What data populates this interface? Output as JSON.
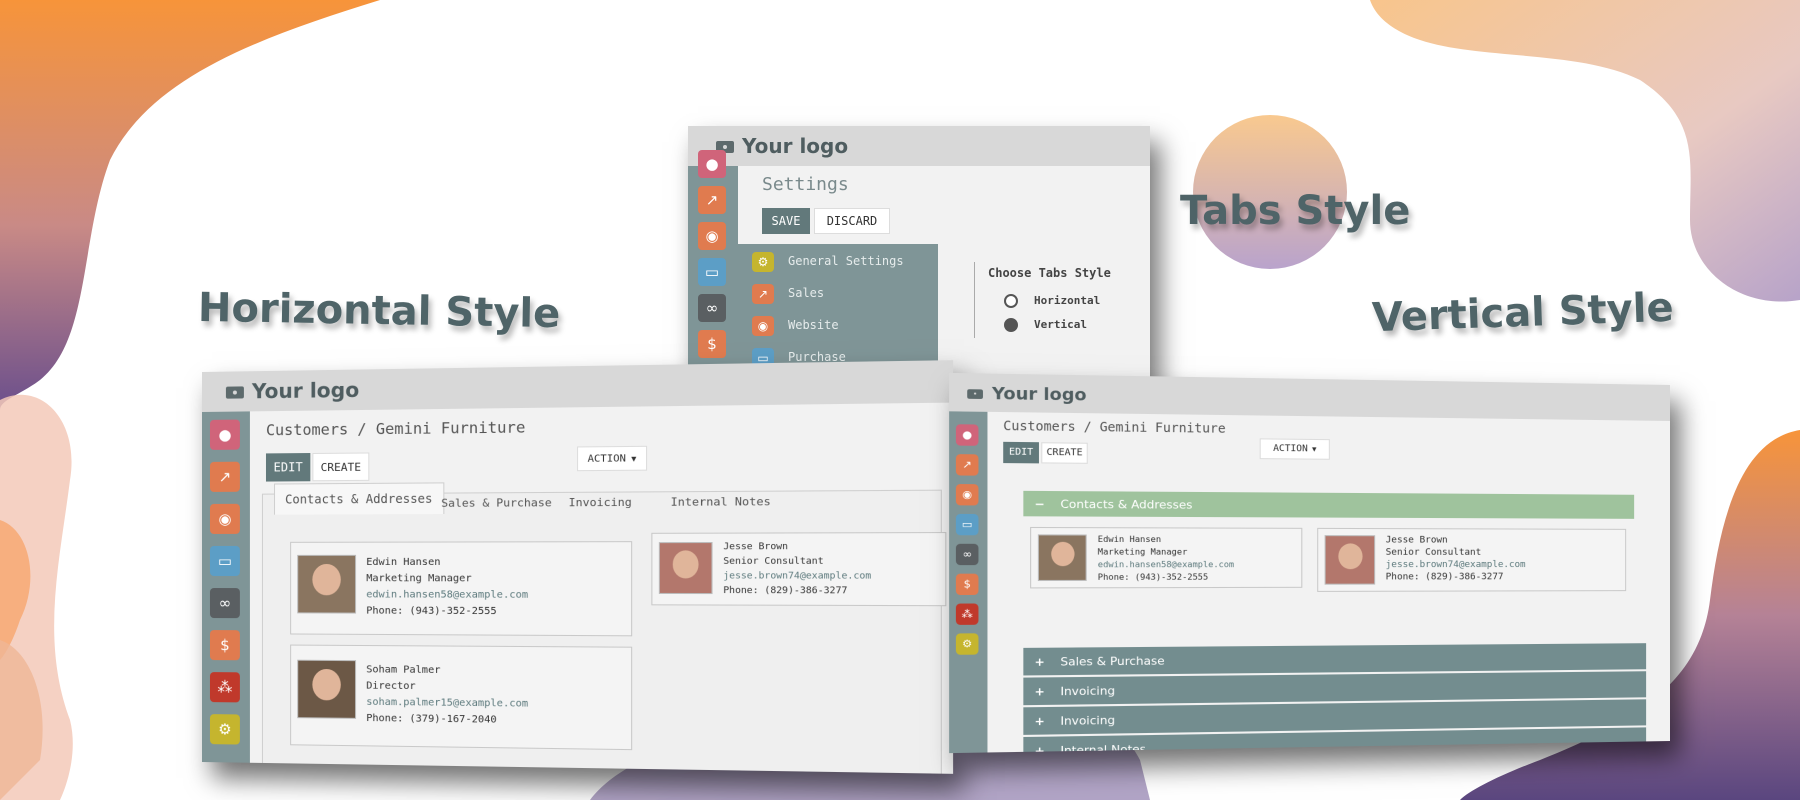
{
  "headings": {
    "horizontal": "Horizontal Style",
    "tabs": "Tabs Style",
    "vertical": "Vertical Style"
  },
  "brand": {
    "logo_text": "Your logo"
  },
  "colors": {
    "accent_dark": "#62797b",
    "sidebar_bg": "#7f9597",
    "accordion_open": "#9fc39d",
    "accordion_closed": "#738d8f",
    "heading": "#4f6468"
  },
  "sidebar_icons": [
    {
      "name": "chat-icon",
      "glyph": "●",
      "color": "#d0647a"
    },
    {
      "name": "chart-icon",
      "glyph": "↗",
      "color": "#e07b4f"
    },
    {
      "name": "globe-icon",
      "glyph": "◉",
      "color": "#e07b4f"
    },
    {
      "name": "card-icon",
      "glyph": "▭",
      "color": "#5c9ec6"
    },
    {
      "name": "link-icon",
      "glyph": "∞",
      "color": "#5a5f62"
    },
    {
      "name": "invoice-icon",
      "glyph": "$",
      "color": "#e07b4f"
    },
    {
      "name": "apps-icon",
      "glyph": "⁂",
      "color": "#c0392b"
    },
    {
      "name": "gear-icon",
      "glyph": "⚙",
      "color": "#c5b52e"
    }
  ],
  "settings": {
    "title": "Settings",
    "save_label": "SAVE",
    "discard_label": "DISCARD",
    "menu": [
      {
        "label": "General Settings",
        "icon": "gear-icon",
        "color": "#c5b52e",
        "glyph": "⚙"
      },
      {
        "label": "Sales",
        "icon": "chart-icon",
        "color": "#e07b4f",
        "glyph": "↗"
      },
      {
        "label": "Website",
        "icon": "globe-icon",
        "color": "#e07b4f",
        "glyph": "◉"
      },
      {
        "label": "Purchase",
        "icon": "card-icon",
        "color": "#5c9ec6",
        "glyph": "▭"
      }
    ],
    "choose_label": "Choose Tabs Style",
    "options": [
      {
        "label": "Horizontal",
        "selected": false
      },
      {
        "label": "Vertical",
        "selected": true
      }
    ]
  },
  "record": {
    "breadcrumb": "Customers / Gemini Furniture",
    "edit_label": "EDIT",
    "create_label": "CREATE",
    "action_label": "ACTION"
  },
  "horizontal_tabs": [
    "Contacts & Addresses",
    "Sales & Purchase",
    "Invoicing",
    "Internal Notes"
  ],
  "contacts": [
    {
      "name": "Edwin Hansen",
      "title": "Marketing Manager",
      "email": "edwin.hansen58@example.com",
      "phone": "Phone: (943)-352-2555"
    },
    {
      "name": "Jesse Brown",
      "title": "Senior Consultant",
      "email": "jesse.brown74@example.com",
      "phone": "Phone: (829)-386-3277"
    },
    {
      "name": "Soham Palmer",
      "title": "Director",
      "email": "soham.palmer15@example.com",
      "phone": "Phone: (379)-167-2040"
    }
  ],
  "vertical_sections": [
    {
      "label": "Contacts & Addresses",
      "symbol": "−",
      "open": true
    },
    {
      "label": "Sales & Purchase",
      "symbol": "+",
      "open": false
    },
    {
      "label": "Invoicing",
      "symbol": "+",
      "open": false
    },
    {
      "label": "Invoicing",
      "symbol": "+",
      "open": false
    },
    {
      "label": "Internal Notes",
      "symbol": "+",
      "open": false
    }
  ]
}
